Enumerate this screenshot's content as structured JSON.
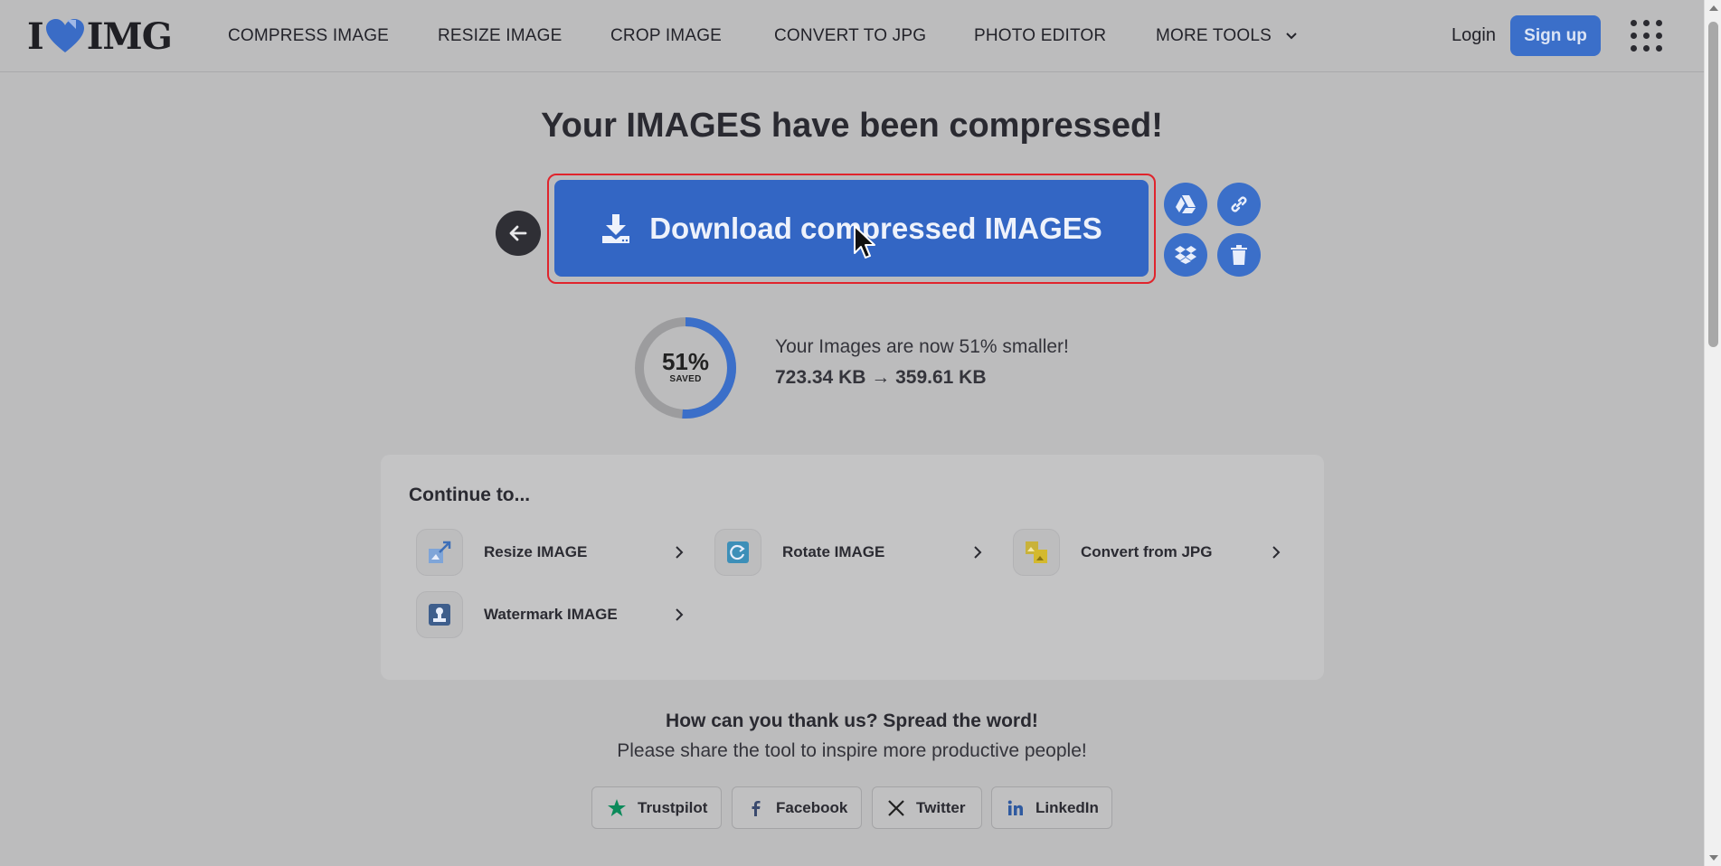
{
  "header": {
    "logo_left": "I",
    "logo_right": "IMG",
    "nav": [
      {
        "label": "COMPRESS IMAGE"
      },
      {
        "label": "RESIZE IMAGE"
      },
      {
        "label": "CROP IMAGE"
      },
      {
        "label": "CONVERT TO JPG"
      },
      {
        "label": "PHOTO EDITOR"
      },
      {
        "label": "MORE TOOLS"
      }
    ],
    "login": "Login",
    "signup": "Sign up"
  },
  "main": {
    "title": "Your IMAGES have been compressed!",
    "download_label": "Download compressed IMAGES",
    "side_buttons": [
      "google-drive-icon",
      "link-icon",
      "dropbox-icon",
      "trash-icon"
    ]
  },
  "savings": {
    "percent_text": "51%",
    "percent_value": 51,
    "saved_label": "SAVED",
    "message": "Your Images are now 51% smaller!",
    "original_size": "723.34 KB",
    "arrow": "→",
    "new_size": "359.61 KB"
  },
  "continue": {
    "title": "Continue to...",
    "tools": [
      {
        "label": "Resize IMAGE",
        "icon": "resize-icon"
      },
      {
        "label": "Rotate IMAGE",
        "icon": "rotate-icon"
      },
      {
        "label": "Convert from JPG",
        "icon": "convert-icon"
      },
      {
        "label": "Watermark IMAGE",
        "icon": "watermark-icon"
      }
    ]
  },
  "share": {
    "headline": "How can you thank us? Spread the word!",
    "subline": "Please share the tool to inspire more productive people!",
    "buttons": [
      {
        "label": "Trustpilot"
      },
      {
        "label": "Facebook"
      },
      {
        "label": "Twitter"
      },
      {
        "label": "LinkedIn"
      }
    ]
  },
  "colors": {
    "accent": "#3366c4",
    "highlight_border": "#e0242c",
    "background": "#bcbcbd"
  }
}
